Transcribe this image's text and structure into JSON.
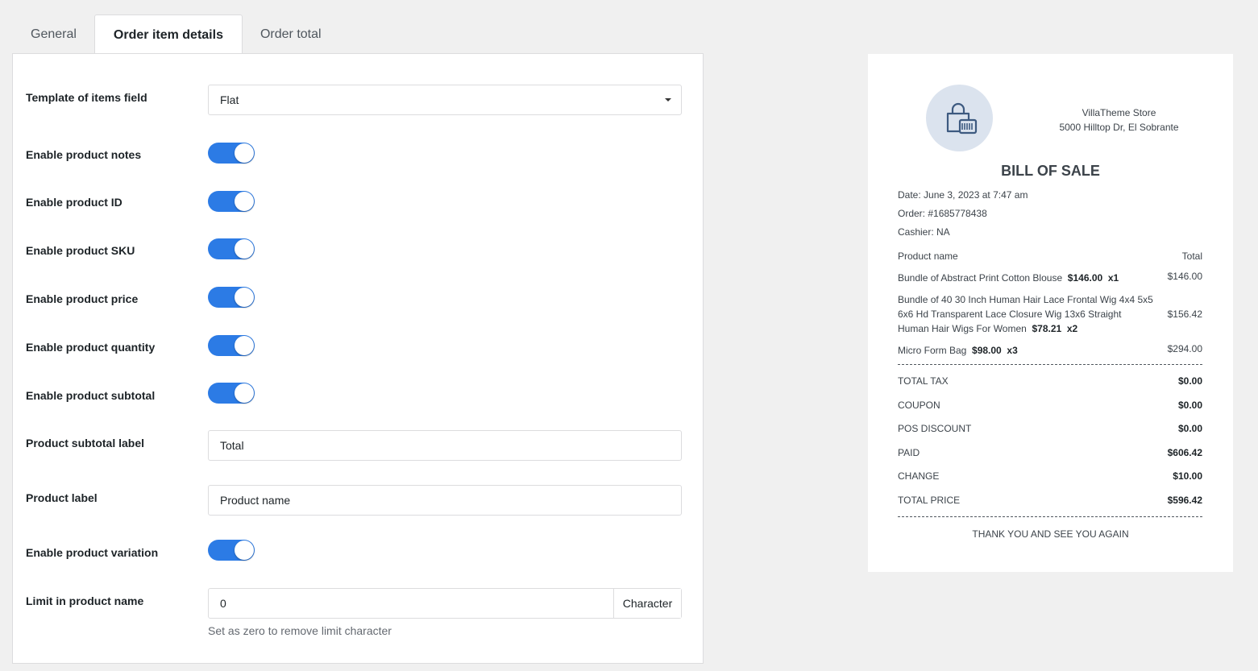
{
  "tabs": [
    "General",
    "Order item details",
    "Order total"
  ],
  "form": {
    "template_label": "Template of items field",
    "template_value": "Flat",
    "notes_label": "Enable product notes",
    "id_label": "Enable product ID",
    "sku_label": "Enable product SKU",
    "price_label": "Enable product price",
    "quantity_label": "Enable product quantity",
    "subtotal_label": "Enable product subtotal",
    "subtotal_text_label": "Product subtotal label",
    "subtotal_text_value": "Total",
    "product_label_label": "Product label",
    "product_label_value": "Product name",
    "variation_label": "Enable product variation",
    "limit_label": "Limit in product name",
    "limit_value": "0",
    "limit_unit": "Character",
    "limit_hint": "Set as zero to remove limit character",
    "toggle_color": "#2c7be5"
  },
  "receipt": {
    "store_name": "VillaTheme Store",
    "store_address": "5000 Hilltop Dr, El Sobrante",
    "title": "BILL OF SALE",
    "date": "Date:  June 3, 2023 at 7:47 am",
    "order": "Order:  #1685778438",
    "cashier": "Cashier:  NA",
    "col_name": "Product name",
    "col_total": "Total",
    "items": [
      {
        "name": "Bundle of Abstract Print Cotton Blouse",
        "price": "$146.00",
        "qty": "x1",
        "total": "$146.00"
      },
      {
        "name": "Bundle of 40 30 Inch Human Hair Lace Frontal Wig 4x4 5x5 6x6 Hd Transparent Lace Closure Wig 13x6 Straight Human Hair Wigs For Women",
        "price": "$78.21",
        "qty": "x2",
        "total": "$156.42"
      },
      {
        "name": "Micro Form Bag",
        "price": "$98.00",
        "qty": "x3",
        "total": "$294.00"
      }
    ],
    "totals": [
      {
        "label": "TOTAL TAX",
        "value": "$0.00"
      },
      {
        "label": "COUPON",
        "value": "$0.00"
      },
      {
        "label": "POS DISCOUNT",
        "value": "$0.00"
      },
      {
        "label": "PAID",
        "value": "$606.42"
      },
      {
        "label": "CHANGE",
        "value": "$10.00"
      },
      {
        "label": "TOTAL PRICE",
        "value": "$596.42"
      }
    ],
    "thanks": "THANK YOU AND SEE YOU AGAIN",
    "logo_icon": "shopping-bag-icon"
  }
}
